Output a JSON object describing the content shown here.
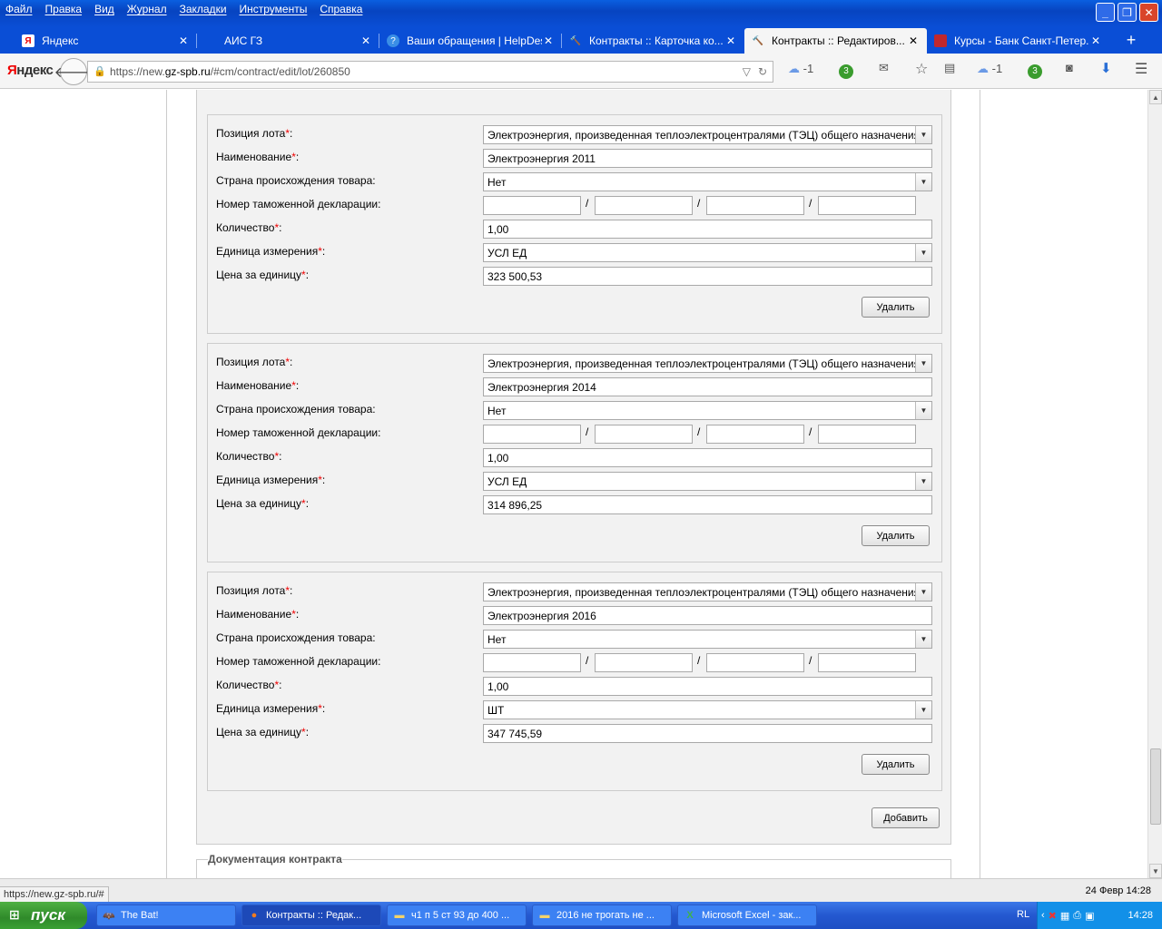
{
  "menu": [
    "Файл",
    "Правка",
    "Вид",
    "Журнал",
    "Закладки",
    "Инструменты",
    "Справка"
  ],
  "tabs": [
    {
      "label": "Яндекс",
      "icon": "Я"
    },
    {
      "label": "АИС ГЗ",
      "icon": ""
    },
    {
      "label": "Ваши обращения | HelpDes...",
      "icon": "?"
    },
    {
      "label": "Контракты :: Карточка ко...",
      "icon": "🔨"
    },
    {
      "label": "Контракты :: Редактиров...",
      "icon": "🔨"
    },
    {
      "label": "Курсы - Банк Санкт-Петер...",
      "icon": "■"
    }
  ],
  "new_tab_label": "+",
  "browser": {
    "logo_prefix": "Я",
    "logo_rest": "ндекс",
    "url_prefix": "https://new.",
    "url_host": "gz-spb.ru",
    "url_path": "/#cm/contract/edit/lot/260850",
    "weather_1": "-1",
    "badge_1": "3",
    "weather_2": "-1",
    "badge_2": "3"
  },
  "labels": {
    "position": "Позиция лота ",
    "name": "Наименование ",
    "country": "Страна происхождения товара:",
    "customs": "Номер таможенной декларации:",
    "quantity": "Количество ",
    "unit": "Единица измерения ",
    "price": "Цена за единицу ",
    "req_mark": "*",
    "colon": ":",
    "slash": "/",
    "delete": "Удалить",
    "add": "Добавить"
  },
  "lots": [
    {
      "position": "Электроэнергия, произведенная теплоэлектроцентралями (ТЭЦ) общего назначения",
      "name": "Электроэнергия 2011",
      "country": "Нет",
      "quantity": "1,00",
      "unit": "УСЛ ЕД",
      "price": "323 500,53"
    },
    {
      "position": "Электроэнергия, произведенная теплоэлектроцентралями (ТЭЦ) общего назначения",
      "name": "Электроэнергия 2014",
      "country": "Нет",
      "quantity": "1,00",
      "unit": "УСЛ ЕД",
      "price": "314 896,25"
    },
    {
      "position": "Электроэнергия, произведенная теплоэлектроцентралями (ТЭЦ) общего назначения",
      "name": "Электроэнергия 2016",
      "country": "Нет",
      "quantity": "1,00",
      "unit": "ШТ",
      "price": "347 745,59"
    }
  ],
  "documentation_legend": "Документация контракта",
  "status": {
    "url": "https://new.gz-spb.ru/#",
    "date": "24 Февр 14:28"
  },
  "taskbar": {
    "start": "пуск",
    "tasks": [
      {
        "label": "The Bat!"
      },
      {
        "label": "Контракты :: Редак..."
      },
      {
        "label": "ч1 п 5 ст 93 до 400 ..."
      },
      {
        "label": "2016 не трогать не ..."
      },
      {
        "label": "Microsoft Excel - зак..."
      }
    ],
    "lang": "RL",
    "clock": "14:28"
  }
}
